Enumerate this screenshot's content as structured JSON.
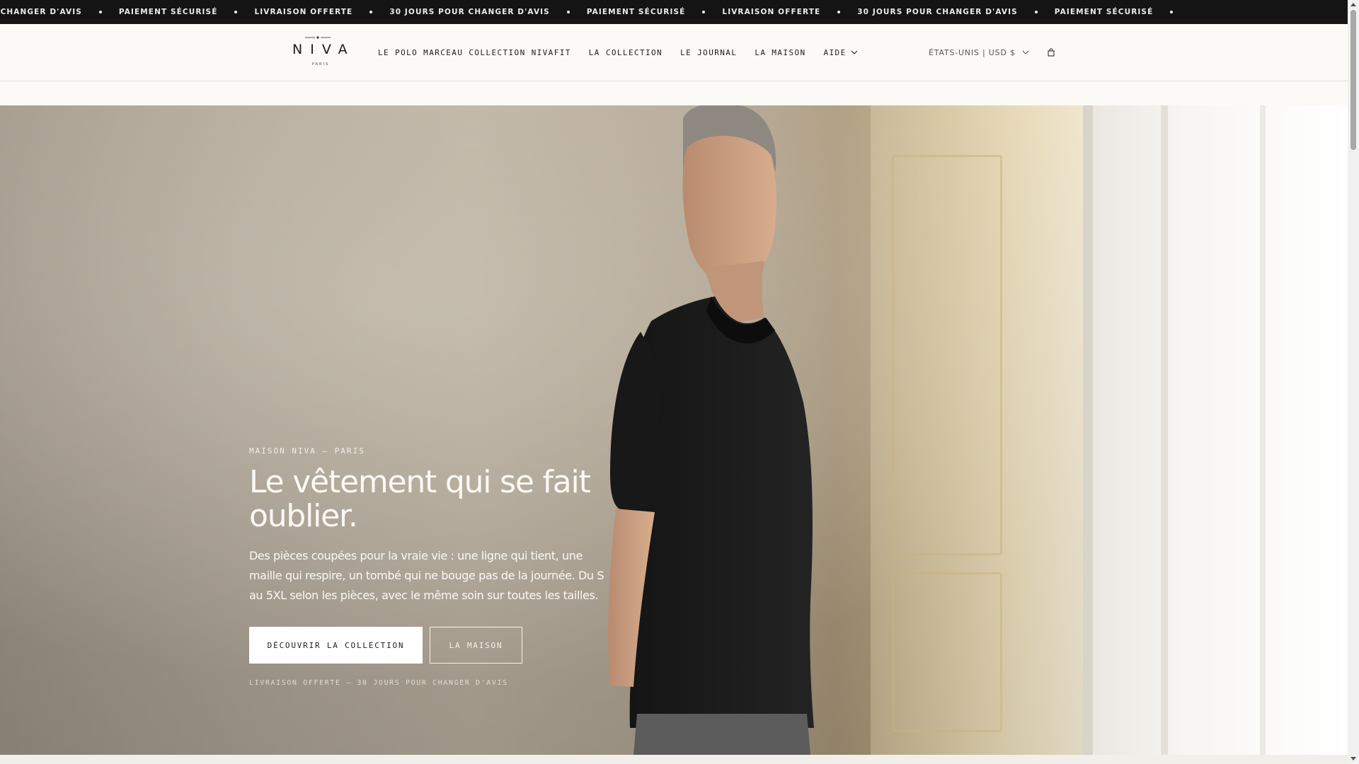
{
  "announcement": {
    "items": [
      "URS POUR CHANGER D'AVIS",
      "PAIEMENT SÉCURISÉ",
      "LIVRAISON OFFERTE",
      "30 JOURS POUR CHANGER D'AVIS",
      "PAIEMENT SÉCURISÉ",
      "LIVRAISON OFFERTE",
      "30 JOURS POUR CHANGER D'AVIS",
      "PAIEMENT SÉCURISÉ"
    ]
  },
  "header": {
    "logo_text": "NIVA",
    "logo_sub": "PARIS",
    "nav": [
      "LE POLO MARCEAU COLLECTION NIVAFIT",
      "LA COLLECTION",
      "LE JOURNAL",
      "LA MAISON",
      "AIDE"
    ],
    "locale": "ÉTATS-UNIS | USD $",
    "cart_icon": "shopping-bag-icon"
  },
  "hero": {
    "eyebrow": "MAISON NIVA — PARIS",
    "headline": "Le vêtement qui se fait oublier.",
    "body": "Des pièces coupées pour la vraie vie : une ligne qui tient, une maille qui respire, un tombé qui ne bouge pas de la journée. Du S au 5XL selon les pièces, avec le même soin sur toutes les tailles.",
    "primary_cta": "DÉCOUVRIR LA COLLECTION",
    "secondary_cta": "LA MAISON",
    "note": "LIVRAISON OFFERTE — 30 JOURS POUR CHANGER D'AVIS"
  },
  "colors": {
    "announcement_bg": "#141414",
    "header_bg": "#fbfaf6",
    "text_dark": "#1c1c1c",
    "hero_text": "#fbf9f5"
  }
}
